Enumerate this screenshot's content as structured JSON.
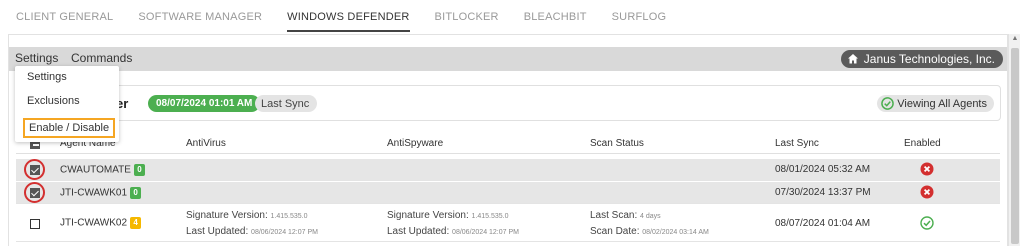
{
  "tabs": [
    {
      "label": "CLIENT GENERAL",
      "active": false
    },
    {
      "label": "SOFTWARE MANAGER",
      "active": false
    },
    {
      "label": "WINDOWS DEFENDER",
      "active": true
    },
    {
      "label": "BITLOCKER",
      "active": false
    },
    {
      "label": "BLEACHBIT",
      "active": false
    },
    {
      "label": "SURFLOG",
      "active": false
    }
  ],
  "header": {
    "settings_label": "Settings",
    "commands_label": "Commands",
    "company": "Janus Technologies, Inc.",
    "company_icon": "home-icon"
  },
  "subheader": {
    "title_fragment": "er",
    "sync_date": "08/07/2024 01:01 AM",
    "sync_label": "Last Sync",
    "viewing_label": "Viewing All Agents"
  },
  "dropdown": {
    "items": [
      "Settings",
      "Exclusions",
      "Enable / Disable"
    ],
    "highlighted": "Enable / Disable"
  },
  "table": {
    "columns": [
      "Agent Name",
      "AntiVirus",
      "AntiSpyware",
      "Scan Status",
      "Last Sync",
      "Enabled"
    ],
    "rows": [
      {
        "name": "CWAUTOMATE",
        "count": "0",
        "count_color": "#4caf50",
        "checked": true,
        "av_sig_label": "",
        "av_sig": "",
        "av_upd_label": "",
        "av_upd": "",
        "as_sig_label": "",
        "as_sig": "",
        "as_upd_label": "",
        "as_upd": "",
        "scan_label": "",
        "scan": "",
        "scan_date_label": "",
        "scan_date": "",
        "last_sync": "08/01/2024 05:32 AM",
        "enabled": "x-circle-icon"
      },
      {
        "name": "JTI-CWAWK01",
        "count": "0",
        "count_color": "#4caf50",
        "checked": true,
        "av_sig_label": "",
        "av_sig": "",
        "av_upd_label": "",
        "av_upd": "",
        "as_sig_label": "",
        "as_sig": "",
        "as_upd_label": "",
        "as_upd": "",
        "scan_label": "",
        "scan": "",
        "scan_date_label": "",
        "scan_date": "",
        "last_sync": "07/30/2024 13:37 PM",
        "enabled": "x-circle-icon"
      },
      {
        "name": "JTI-CWAWK02",
        "count": "4",
        "count_color": "#f5b800",
        "checked": false,
        "av_sig_label": "Signature Version:",
        "av_sig": "1.415.535.0",
        "av_upd_label": "Last Updated:",
        "av_upd": "08/06/2024 12:07 PM",
        "as_sig_label": "Signature Version:",
        "as_sig": "1.415.535.0",
        "as_upd_label": "Last Updated:",
        "as_upd": "08/06/2024 12:07 PM",
        "scan_label": "Last Scan:",
        "scan": "4 days",
        "scan_date_label": "Scan Date:",
        "scan_date": "08/02/2024 03:14 AM",
        "last_sync": "08/07/2024 01:04 AM",
        "enabled": "check-circle-icon"
      }
    ]
  },
  "colors": {
    "accent_green": "#4caf50",
    "error_red": "#d32f2f",
    "highlight_orange": "#f5a623",
    "header_gray": "#d9d9d9"
  }
}
